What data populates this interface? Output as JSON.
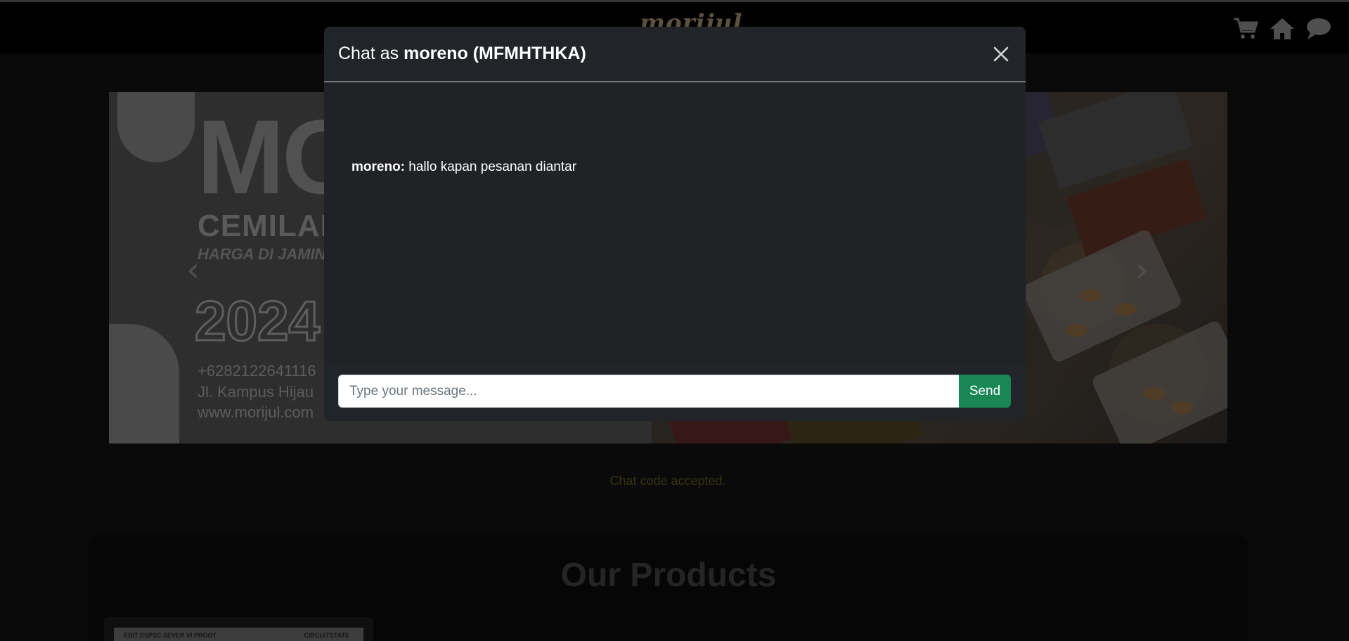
{
  "navbar": {
    "brand": "morijul",
    "icons": [
      "cart-icon",
      "home-icon",
      "chat-icon"
    ]
  },
  "carousel": {
    "slide": {
      "logo_text": "MO",
      "subtitle": "CEMILAN U",
      "tagline": "HARGA DI JAMIN TER",
      "year": "2024",
      "phone": "+6282122641116",
      "address": "Jl. Kampus Hijau",
      "website": "www.morijul.com"
    },
    "prev_icon": "chevron-left-icon",
    "next_icon": "chevron-right-icon"
  },
  "status": {
    "message": "Chat code accepted.",
    "color": "#6e6426"
  },
  "products": {
    "title": "Our Products",
    "card": {
      "badge_left": "EDIT ESPSC SEVER VI PROOT",
      "badge_right": "CIRCUITSTATE"
    }
  },
  "modal": {
    "title_prefix": "Chat as",
    "title_user": "moreno (MFMHTHKA)",
    "close_icon": "close-icon",
    "messages": [
      {
        "sender": "moreno:",
        "text": "hallo kapan pesanan diantar"
      }
    ],
    "input": {
      "placeholder": "Type your message...",
      "value": ""
    },
    "send_label": "Send",
    "send_color": "#198754"
  }
}
